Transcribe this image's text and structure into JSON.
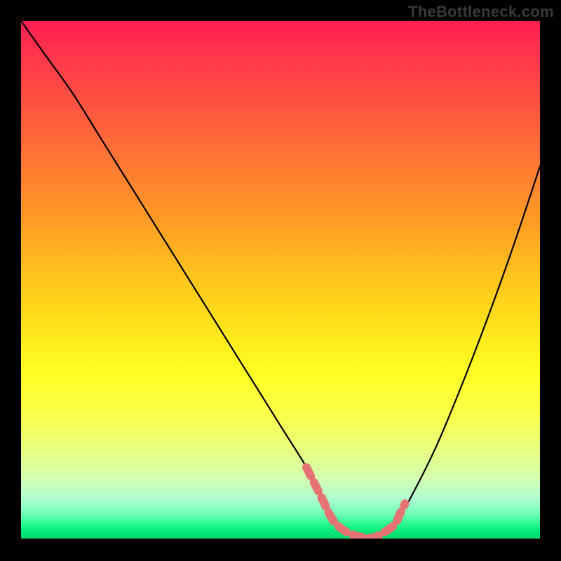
{
  "watermark": "TheBottleneck.com",
  "colors": {
    "curve": "#000000",
    "highlight": "#e57373",
    "background_top": "#ff1f52",
    "background_bottom": "#00d868"
  },
  "chart_data": {
    "type": "line",
    "title": "",
    "xlabel": "",
    "ylabel": "",
    "xlim": [
      0,
      100
    ],
    "ylim": [
      0,
      100
    ],
    "series": [
      {
        "name": "bottleneck-curve",
        "x": [
          0,
          5,
          10,
          15,
          20,
          25,
          30,
          35,
          40,
          45,
          50,
          55,
          58,
          60,
          62,
          65,
          68,
          70,
          72,
          75,
          80,
          85,
          90,
          95,
          100
        ],
        "y": [
          100,
          93,
          86,
          78,
          70,
          62,
          54,
          46,
          38,
          30,
          22,
          14,
          8,
          4,
          2,
          0.5,
          0.5,
          1.5,
          3,
          8,
          18,
          30,
          43,
          57,
          72
        ]
      },
      {
        "name": "sweet-spot-highlight",
        "x": [
          55,
          56,
          58,
          60,
          62,
          64,
          66,
          68,
          70,
          72,
          73,
          74
        ],
        "y": [
          14,
          12,
          8,
          4,
          2,
          1,
          0.5,
          0.5,
          1.5,
          3,
          5,
          7
        ]
      }
    ],
    "annotations": []
  }
}
